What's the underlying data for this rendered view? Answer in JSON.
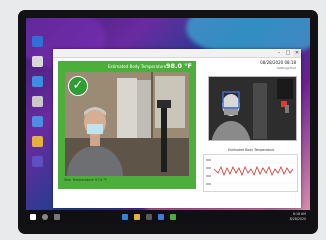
{
  "app": {
    "title": "",
    "minimize": "–",
    "maximize": "□",
    "close": "✕"
  },
  "header": {
    "datetime": "08/28/2020 08:18",
    "settings_label": "Settings   Exit"
  },
  "visible_camera": {
    "temp_label": "Estimated Body Temperature",
    "temp_value": "98.0 °F",
    "status_icon": "check-icon",
    "caption": "Skin Temperature   97.8 °F",
    "panel_color": "#4caf3c"
  },
  "thermal_camera": {
    "crosshair_icon": "target-icon"
  },
  "graph": {
    "title": "Estimated Body Temperature",
    "line_color": "#d6322d"
  },
  "taskbar": {
    "start_icon": "windows-icon",
    "search_icon": "search-icon",
    "tray_time": "8:18 AM",
    "tray_date": "8/28/2020"
  }
}
